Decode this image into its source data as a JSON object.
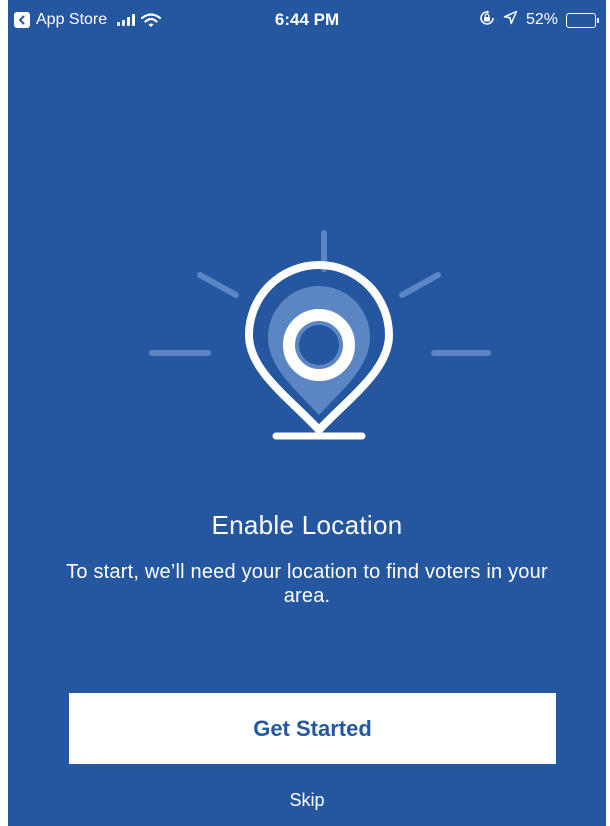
{
  "status_bar": {
    "back_app_label": "App Store",
    "time": "6:44 PM",
    "battery_percent": "52%",
    "battery_level": 0.52,
    "icons": [
      "back-arrow-icon",
      "cellular-signal-icon",
      "wifi-icon",
      "orientation-lock-icon",
      "location-arrow-icon",
      "battery-icon"
    ]
  },
  "onboarding": {
    "illustration_icon": "location-pin-icon",
    "title": "Enable Location",
    "description": "To start, we’ll need your location to find voters in your area.",
    "primary_button_label": "Get Started",
    "skip_label": "Skip"
  },
  "colors": {
    "background": "#2556a0",
    "accent_light": "#5b86c3",
    "text": "#ffffff",
    "button_background": "#ffffff",
    "button_text": "#2556a0"
  }
}
